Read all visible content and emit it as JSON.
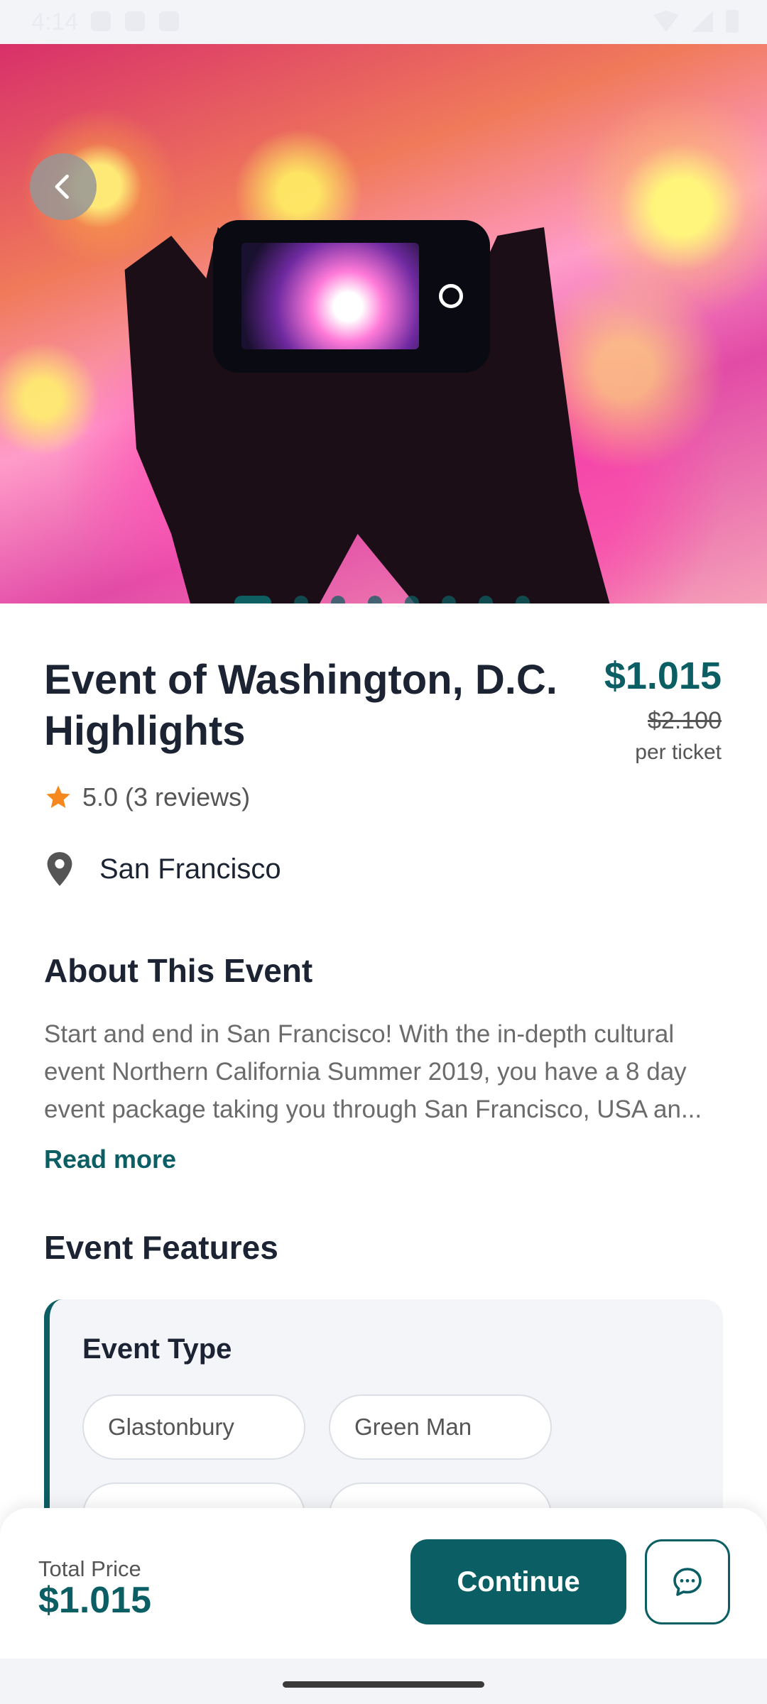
{
  "status_bar": {
    "time": "4:14"
  },
  "hero": {
    "active_slide": 1,
    "slide_count": 8
  },
  "event": {
    "title": "Event of Washington, D.C. Highlights",
    "price": "$1.015",
    "original_price": "$2.100",
    "price_unit": "per ticket",
    "rating_text": "5.0 (3 reviews)",
    "location": "San Francisco"
  },
  "about": {
    "heading": "About This Event",
    "text": "Start and end in San Francisco! With the in-depth cultural event Northern California Summer 2019, you have a 8 day event package taking you through San Francisco, USA an...",
    "read_more": "Read more"
  },
  "features": {
    "heading": "Event Features",
    "type_title": "Event Type",
    "chips": [
      "Glastonbury",
      "Green Man"
    ]
  },
  "bottom_bar": {
    "total_label": "Total Price",
    "total_value": "$1.015",
    "continue_label": "Continue"
  },
  "icons": {
    "back": "chevron-left-icon",
    "star": "star-icon",
    "location": "location-pin-icon",
    "chat": "chat-bubble-icon"
  },
  "colors": {
    "accent": "#0b5e63",
    "star": "#f5891f"
  }
}
